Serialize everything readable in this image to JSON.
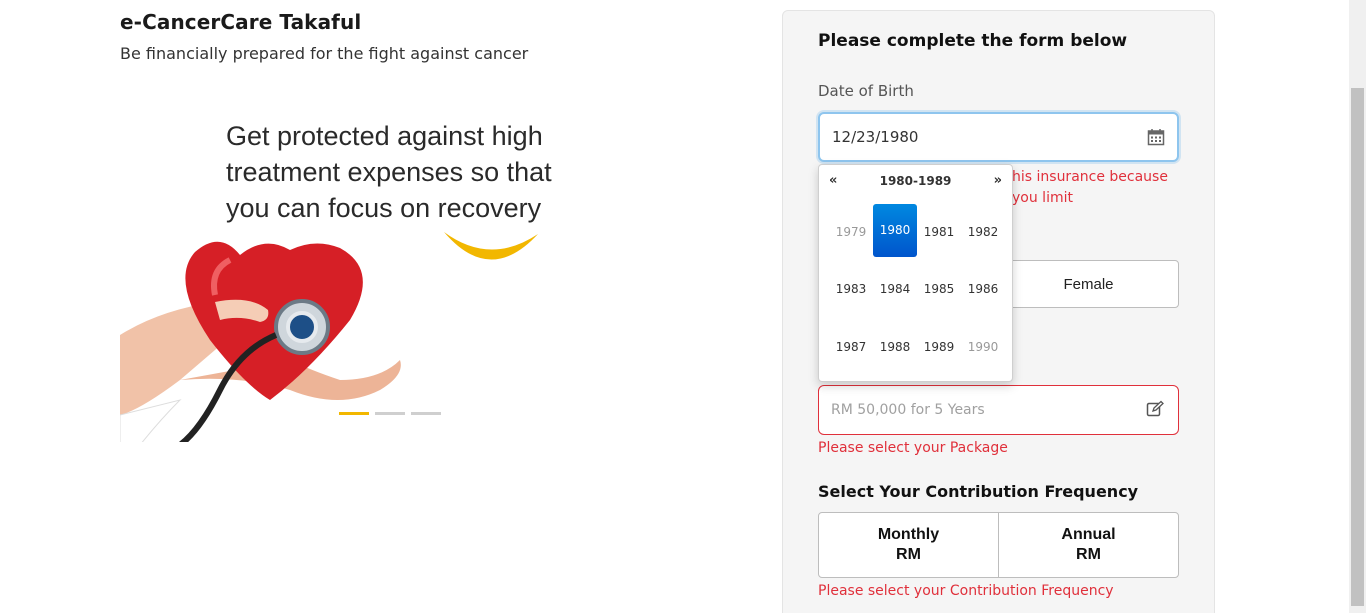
{
  "product": {
    "title": "e-CancerCare Takaful",
    "subtitle": "Be financially prepared for the fight against cancer"
  },
  "hero": {
    "headline": "Get protected against high treatment expenses so that you can focus on recovery",
    "carousel": {
      "slides": 3,
      "active_index": 0
    }
  },
  "form": {
    "title": "Please complete the form below",
    "dob": {
      "label": "Date of Birth",
      "value": "12/23/1980",
      "error_partial": "his insurance because you limit"
    },
    "gender": {
      "options": [
        "",
        "Female"
      ]
    },
    "package": {
      "placeholder": "RM 50,000 for 5 Years",
      "error": "Please select your Package"
    },
    "frequency": {
      "label": "Select Your Contribution Frequency",
      "options": [
        {
          "period": "Monthly",
          "amount": "RM"
        },
        {
          "period": "Annual",
          "amount": "RM"
        }
      ],
      "error": "Please select your Contribution Frequency"
    }
  },
  "datepicker": {
    "prev": "«",
    "next": "»",
    "range": "1980-1989",
    "years": [
      "1979",
      "1980",
      "1981",
      "1982",
      "1983",
      "1984",
      "1985",
      "1986",
      "1987",
      "1988",
      "1989",
      "1990"
    ],
    "selected": "1980",
    "muted": [
      "1979",
      "1990"
    ]
  },
  "colors": {
    "error": "#e0303b",
    "accent_yellow": "#f2b700",
    "selected_blue": "#0066d6",
    "focus_border": "#8ec5ee"
  }
}
